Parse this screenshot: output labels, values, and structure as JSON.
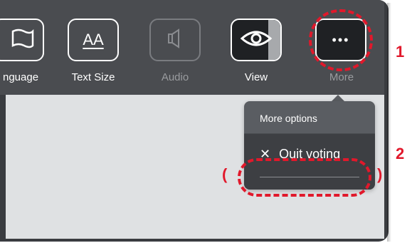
{
  "toolbar": {
    "items": [
      {
        "label": "nguage",
        "icon": "flag-icon"
      },
      {
        "label": "Text Size",
        "icon_text": "AA"
      },
      {
        "label": "Audio",
        "icon": "speaker-icon"
      },
      {
        "label": "View",
        "icon": "eye-icon"
      },
      {
        "label": "More",
        "icon_text": "•••"
      }
    ]
  },
  "popup": {
    "title": "More options",
    "quit": {
      "icon": "✕",
      "label": "Quit voting"
    }
  },
  "annotations": {
    "callout_1": "1",
    "callout_2": "2",
    "bracket_left": "(",
    "bracket_right": ")"
  },
  "colors": {
    "annotation_red": "#e1182b",
    "toolbar_bg": "#4a4c50",
    "content_bg": "#dfe1e3"
  }
}
